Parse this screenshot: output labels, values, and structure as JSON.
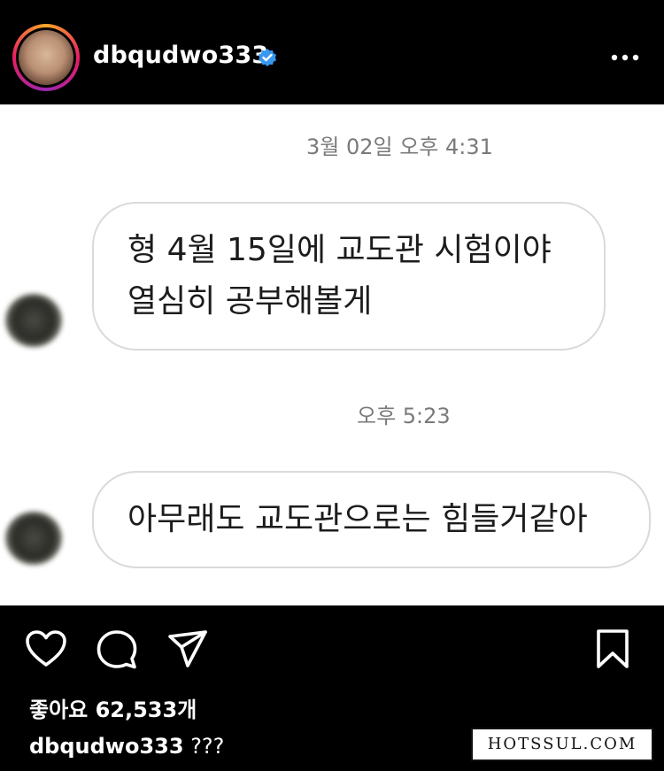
{
  "header": {
    "username": "dbqudwo333",
    "verified_icon": "verified-badge-icon",
    "more_icon": "more-options-icon",
    "accent": "#3897f0"
  },
  "chat": {
    "timestamp_1": "3월 02일 오후 4:31",
    "message_1": {
      "line1": "형 4월 15일에 교도관 시험이야",
      "line2": "열심히 공부해볼게"
    },
    "timestamp_2": "오후 5:23",
    "message_2": {
      "line1": "아무래도 교도관으로는 힘들거같아"
    }
  },
  "actions": {
    "like_icon": "heart-icon",
    "comment_icon": "comment-icon",
    "share_icon": "share-icon",
    "save_icon": "bookmark-icon"
  },
  "likes_text": "좋아요 62,533개",
  "caption": {
    "user": "dbqudwo333",
    "text": " ???"
  },
  "watermark": "HOTSSUL.COM"
}
